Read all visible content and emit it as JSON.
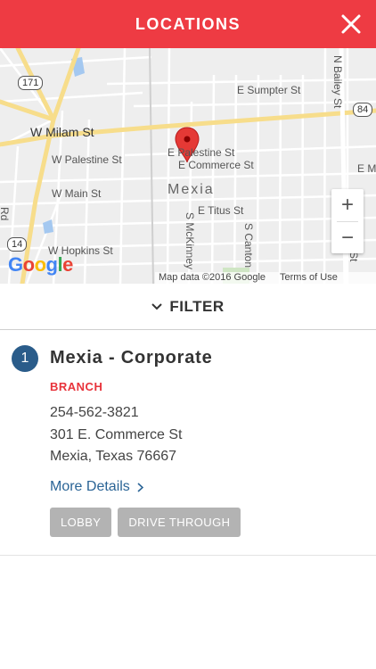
{
  "header": {
    "title": "LOCATIONS",
    "close_icon": "close-x-icon"
  },
  "map": {
    "street_labels": {
      "e_sumpter": "E Sumpter St",
      "w_milam": "W Milam St",
      "w_palestine": "W Palestine St",
      "e_palestine": "E Palestine St",
      "e_commerce": "E Commerce St",
      "e_m": "E M",
      "w_main": "W Main St",
      "e_titus": "E Titus St",
      "w_hopkins": "W Hopkins St",
      "n_bailey": "N Bailey St",
      "s_mckinney": "S McKinney",
      "s_canton": "S Canton",
      "rd": "Rd",
      "st": "St"
    },
    "city_label": "Mexia",
    "route_shields": [
      "171",
      "84",
      "14"
    ],
    "zoom_in": "+",
    "zoom_out": "−",
    "logo": [
      "G",
      "o",
      "o",
      "g",
      "l",
      "e"
    ],
    "logo_colors": [
      "#4285f4",
      "#ea4335",
      "#fbbc05",
      "#4285f4",
      "#34a853",
      "#ea4335"
    ],
    "attribution": "Map data ©2016 Google",
    "terms": "Terms of Use"
  },
  "filter": {
    "label": "FILTER",
    "icon": "chevron-down-icon"
  },
  "locations": [
    {
      "number": "1",
      "name": "Mexia - Corporate",
      "type": "BRANCH",
      "phone": "254-562-3821",
      "address_line1": "301 E. Commerce St",
      "address_line2": "Mexia, Texas 76667",
      "more_details": "More Details",
      "tags": [
        "LOBBY",
        "DRIVE THROUGH"
      ]
    }
  ],
  "colors": {
    "header_bg": "#ee3b43",
    "badge_bg": "#2a5c8a",
    "branch_red": "#e8333b",
    "link_blue": "#2a6496",
    "tag_gray": "#b3b3b3"
  }
}
